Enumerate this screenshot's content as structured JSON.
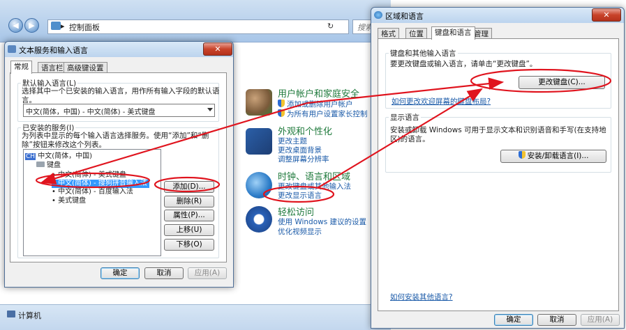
{
  "control_panel": {
    "address": "控制面板",
    "address_sep": "▸",
    "search_placeholder": "搜索",
    "status": "计算机",
    "categories": [
      {
        "title": "用户帐户和家庭安全",
        "links": [
          "添加或删除用户帐户",
          "为所有用户设置家长控制"
        ]
      },
      {
        "title": "外观和个性化",
        "links": [
          "更改主题",
          "更改桌面背景",
          "调整屏幕分辨率"
        ]
      },
      {
        "title": "时钟、语言和区域",
        "links": [
          "更改键盘或其他输入法",
          "更改显示语言"
        ]
      },
      {
        "title": "轻松访问",
        "links": [
          "使用 Windows 建议的设置",
          "优化视频显示"
        ]
      }
    ]
  },
  "text_services": {
    "title": "文本服务和输入语言",
    "close": "✕",
    "tabs": [
      "常规",
      "语言栏",
      "高级键设置"
    ],
    "default_group": "默认输入语言(L)",
    "default_desc": "选择其中一个已安装的输入语言，用作所有输入字段的默认语言。",
    "default_value": "中文(简体，中国) - 中文(简体) - 美式键盘",
    "installed_group": "已安装的服务(I)",
    "installed_desc": "为列表中显示的每个输入语言选择服务。使用“添加”和“删除”按钮来修改这个列表。",
    "tree": {
      "lang_badge": "CH",
      "language": "中文(简体，中国)",
      "keyboard": "键盘",
      "items": [
        "中文(简体) - 美式键盘",
        "中文(简体) - 搜狗拼音输入法",
        "中文(简体) - 百度输入法",
        "美式键盘"
      ]
    },
    "buttons": {
      "add": "添加(D)...",
      "remove": "删除(R)",
      "properties": "属性(P)...",
      "move_up": "上移(U)",
      "move_down": "下移(O)"
    },
    "footer": {
      "ok": "确定",
      "cancel": "取消",
      "apply": "应用(A)"
    }
  },
  "region_language": {
    "title": "区域和语言",
    "close": "✕",
    "tabs": [
      "格式",
      "位置",
      "键盘和语言",
      "管理"
    ],
    "keyboard_group": "键盘和其他输入语言",
    "keyboard_desc": "要更改键盘或输入语言，请单击“更改键盘”。",
    "change_keyboard": "更改键盘(C)...",
    "welcome_link": "如何更改欢迎屏幕的键盘布局?",
    "display_group": "显示语言",
    "display_desc": "安装或卸载 Windows 可用于显示文本和识别语音和手写(在支持地区)的语言。",
    "install_button": "安装/卸载语言(I)...",
    "other_lang_link": "如何安装其他语言?",
    "footer": {
      "ok": "确定",
      "cancel": "取消",
      "apply": "应用(A)"
    }
  },
  "colors": {
    "annotation": "#e0141e",
    "link": "#1a5aa8",
    "category_title": "#1f7a3c",
    "selection": "#3399ff"
  }
}
